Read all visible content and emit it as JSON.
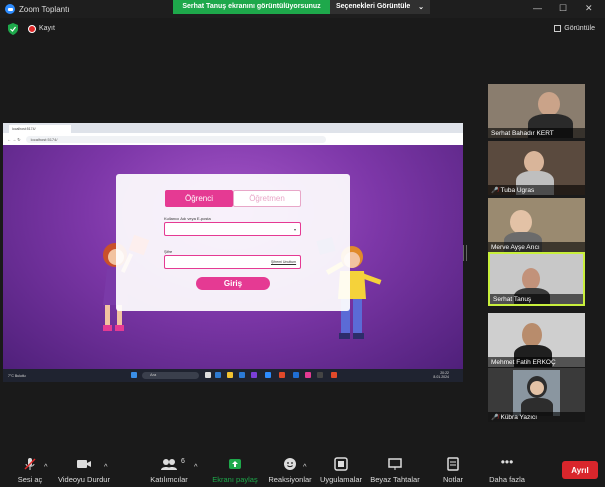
{
  "window": {
    "title": "Zoom Toplantı",
    "share_banner": "Serhat Tanuş ekranını görüntülüyorsunuz",
    "view_options": "Seçenekleri Görüntüle",
    "minimize": "—",
    "maximize": "☐",
    "close": "✕"
  },
  "status": {
    "record_label": "Kayıt",
    "view_label": "Görüntüle"
  },
  "shared_screen": {
    "browser_tab": "localhost:5174/",
    "url": "localhost:5174/",
    "page": {
      "tab_student": "Öğrenci",
      "tab_teacher": "Öğretmen",
      "username_label": "Kullanıcı Adı veya E-posta",
      "password_label": "Şifre",
      "forgot_password": "Şifremi Unuttum",
      "login_button": "Giriş"
    },
    "taskbar": {
      "weather": "7°C Bulutlu",
      "search": "Ara",
      "time": "20:22",
      "date": "8.01.2024"
    }
  },
  "participants": [
    {
      "name": "Serhat Bahadır KERT",
      "muted": false,
      "active": false
    },
    {
      "name": "Tuba Ugras",
      "muted": true,
      "active": false
    },
    {
      "name": "Merve Ayşe Arıcı",
      "muted": false,
      "active": false
    },
    {
      "name": "Serhat Tanuş",
      "muted": false,
      "active": true
    },
    {
      "name": "Mehmet Fatih ERKOÇ",
      "muted": false,
      "active": false
    },
    {
      "name": "Kübra Yazıcı",
      "muted": true,
      "active": false
    }
  ],
  "toolbar": {
    "unmute": "Sesi aç",
    "stop_video": "Videoyu Durdur",
    "participants": "Katılımcılar",
    "participants_count": "6",
    "share_screen": "Ekranı paylaş",
    "reactions": "Reaksiyonlar",
    "apps": "Uygulamalar",
    "whiteboards": "Beyaz Tahtalar",
    "notes": "Notlar",
    "more": "Daha fazla",
    "leave": "Ayrıl"
  },
  "colors": {
    "share_green": "#1ea84b",
    "leave_red": "#d9262c",
    "accent_pink": "#e53a93",
    "active_speaker": "#c8ef3c"
  }
}
